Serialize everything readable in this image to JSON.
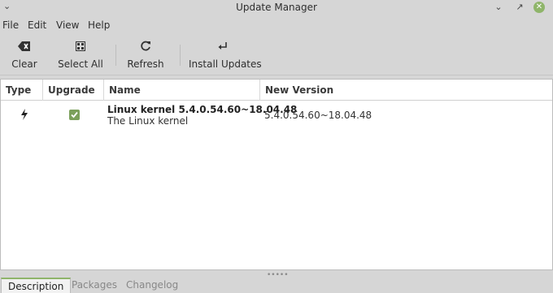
{
  "window": {
    "title": "Update Manager",
    "controls": [
      "minimize-icon",
      "maximize-icon",
      "close-icon"
    ],
    "accent_color": "#8fb56a"
  },
  "menu": [
    "File",
    "Edit",
    "View",
    "Help"
  ],
  "toolbar": {
    "clear": "Clear",
    "select_all": "Select All",
    "refresh": "Refresh",
    "install_updates": "Install Updates"
  },
  "list": {
    "columns": [
      "Type",
      "Upgrade",
      "Name",
      "New Version"
    ],
    "rows": [
      {
        "type_icon": "kernel-lightning-icon",
        "upgrade_checked": true,
        "name": "Linux kernel 5.4.0.54.60~18.04.48",
        "description": "The Linux kernel",
        "new_version": "5.4.0.54.60~18.04.48"
      }
    ]
  },
  "tabs": [
    "Description",
    "Packages",
    "Changelog"
  ]
}
